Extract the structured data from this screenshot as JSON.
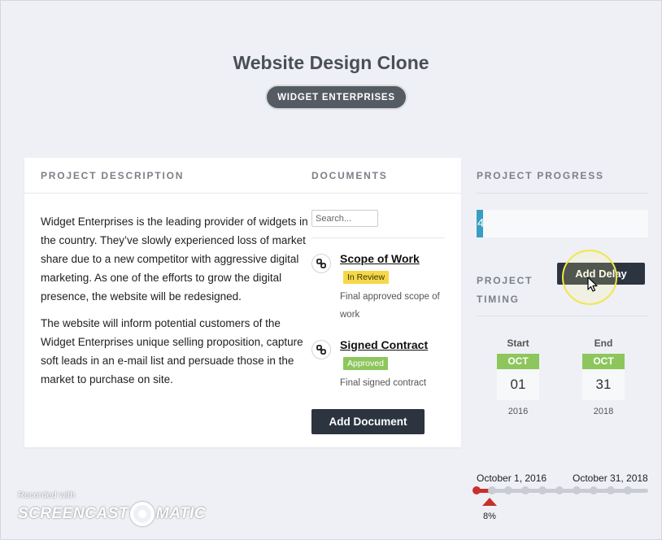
{
  "page": {
    "title": "Website Design Clone",
    "client_badge": "WIDGET ENTERPRISES"
  },
  "project_description": {
    "heading": "PROJECT DESCRIPTION",
    "paragraphs": [
      "Widget Enterprises is the leading provider of widgets in the country. They’ve slowly experienced loss of market share due to a new competitor with aggressive digital marketing. As one of the efforts to grow the digital presence, the website will be redesigned.",
      "The website will inform potential customers of the Widget Enterprises unique selling proposition, capture soft leads in an e-mail list and persuade those in the market to purchase on site."
    ]
  },
  "documents": {
    "heading": "DOCUMENTS",
    "search_placeholder": "Search...",
    "items": [
      {
        "title": "Scope of Work",
        "status": "In Review",
        "status_color": "#f5d84a",
        "note": "Final approved scope of work",
        "icon": "link-icon"
      },
      {
        "title": "Signed Contract",
        "status": "Approved",
        "status_color": "#8dc65c",
        "note": "Final signed contract",
        "icon": "link-icon"
      }
    ],
    "add_button": "Add Document"
  },
  "progress": {
    "heading": "PROJECT PROGRESS",
    "value_text": "4",
    "percent": 4,
    "bar_color": "#3a9ec2"
  },
  "timing": {
    "heading": "PROJECT TIMING",
    "add_delay_button": "Add Delay",
    "start": {
      "label": "Start",
      "month": "OCT",
      "day": "01",
      "year": "2016"
    },
    "end": {
      "label": "End",
      "month": "OCT",
      "day": "31",
      "year": "2018"
    }
  },
  "timeline": {
    "start_label": "October 1, 2016",
    "end_label": "October 31, 2018",
    "percent_label": "8%",
    "percent": 8,
    "fill_color": "#c9302c"
  },
  "watermark": {
    "line1": "Recorded with",
    "brand_left": "SCREENCAST",
    "brand_right": "MATIC"
  }
}
